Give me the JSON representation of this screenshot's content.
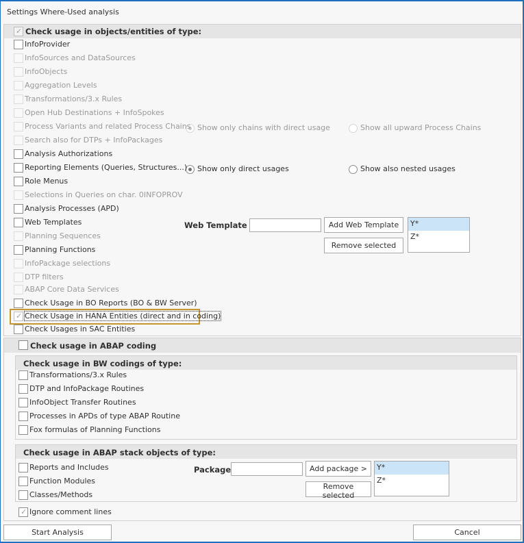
{
  "window": {
    "title": "Settings Where-Used analysis"
  },
  "objects_group": {
    "header": "Check usage in objects/entities of type:",
    "header_checked": true,
    "items": [
      {
        "label": "InfoProvider",
        "checked": false,
        "enabled": true
      },
      {
        "label": "InfoSources and DataSources",
        "checked": false,
        "enabled": false
      },
      {
        "label": "InfoObjects",
        "checked": false,
        "enabled": false
      },
      {
        "label": "Aggregation Levels",
        "checked": false,
        "enabled": false
      },
      {
        "label": "Transformations/3.x Rules",
        "checked": false,
        "enabled": false
      },
      {
        "label": "Open Hub Destinations + InfoSpokes",
        "checked": false,
        "enabled": false
      },
      {
        "label": "Process Variants and related Process Chains",
        "checked": false,
        "enabled": false
      },
      {
        "label": "Search also for DTPs + InfoPackages",
        "checked": false,
        "enabled": false
      },
      {
        "label": "Analysis Authorizations",
        "checked": false,
        "enabled": true
      },
      {
        "label": "Reporting Elements (Queries, Structures...)",
        "checked": false,
        "enabled": true
      },
      {
        "label": "Role Menus",
        "checked": false,
        "enabled": true
      },
      {
        "label": "Selections in Queries on char. 0INFOPROV",
        "checked": false,
        "enabled": false
      },
      {
        "label": "Analysis Processes (APD)",
        "checked": false,
        "enabled": true
      },
      {
        "label": "Web Templates",
        "checked": false,
        "enabled": true
      },
      {
        "label": "Planning Sequences",
        "checked": false,
        "enabled": false
      },
      {
        "label": "Planning Functions",
        "checked": false,
        "enabled": true
      },
      {
        "label": "InfoPackage selections",
        "checked": false,
        "enabled": false
      },
      {
        "label": "DTP filters",
        "checked": false,
        "enabled": false
      },
      {
        "label": "ABAP Core Data Services",
        "checked": false,
        "enabled": false
      },
      {
        "label": "Check Usage in BO Reports (BO & BW Server)",
        "checked": false,
        "enabled": true
      },
      {
        "label": "Check Usage in HANA Entities (direct and in coding)",
        "checked": true,
        "enabled": true
      },
      {
        "label": "Check Usages in SAC Entities",
        "checked": false,
        "enabled": true
      }
    ],
    "process_chain_options": [
      {
        "label": "Show only chains with direct usage",
        "selected": true,
        "enabled": false
      },
      {
        "label": "Show all upward Process Chains",
        "selected": false,
        "enabled": false
      }
    ],
    "reporting_options": [
      {
        "label": "Show only direct usages",
        "selected": true,
        "enabled": true
      },
      {
        "label": "Show also nested usages",
        "selected": false,
        "enabled": true
      }
    ],
    "web_template": {
      "label": "Web Template",
      "input_value": "",
      "add_button": "Add Web Template",
      "remove_button": "Remove selected",
      "list": [
        {
          "value": "Y*",
          "selected": true
        },
        {
          "value": "Z*",
          "selected": false
        }
      ]
    }
  },
  "abap_group": {
    "header": "Check usage in ABAP coding",
    "header_checked": false,
    "bw_codings": {
      "header": "Check usage in BW codings of type:",
      "items": [
        {
          "label": "Transformations/3.x Rules",
          "checked": false
        },
        {
          "label": "DTP and InfoPackage Routines",
          "checked": false
        },
        {
          "label": "InfoObject Transfer Routines",
          "checked": false
        },
        {
          "label": "Processes in APDs of type ABAP Routine",
          "checked": false
        },
        {
          "label": "Fox formulas of Planning Functions",
          "checked": false
        }
      ]
    },
    "abap_stack": {
      "header": "Check usage in ABAP stack objects of type:",
      "items": [
        {
          "label": "Reports and Includes",
          "checked": false
        },
        {
          "label": "Function Modules",
          "checked": false
        },
        {
          "label": "Classes/Methods",
          "checked": false
        }
      ],
      "package": {
        "label": "Package",
        "input_value": "",
        "add_button": "Add package >",
        "remove_button": "Remove selected",
        "list": [
          {
            "value": "Y*",
            "selected": true
          },
          {
            "value": "Z*",
            "selected": false
          }
        ]
      }
    },
    "ignore_comments": {
      "label": "Ignore comment lines",
      "checked": true
    }
  },
  "footer": {
    "start_button": "Start Analysis",
    "cancel_button": "Cancel"
  },
  "colors": {
    "window_border": "#1e6fbf",
    "highlight": "#c8962e",
    "list_selection": "#cce4f7"
  }
}
